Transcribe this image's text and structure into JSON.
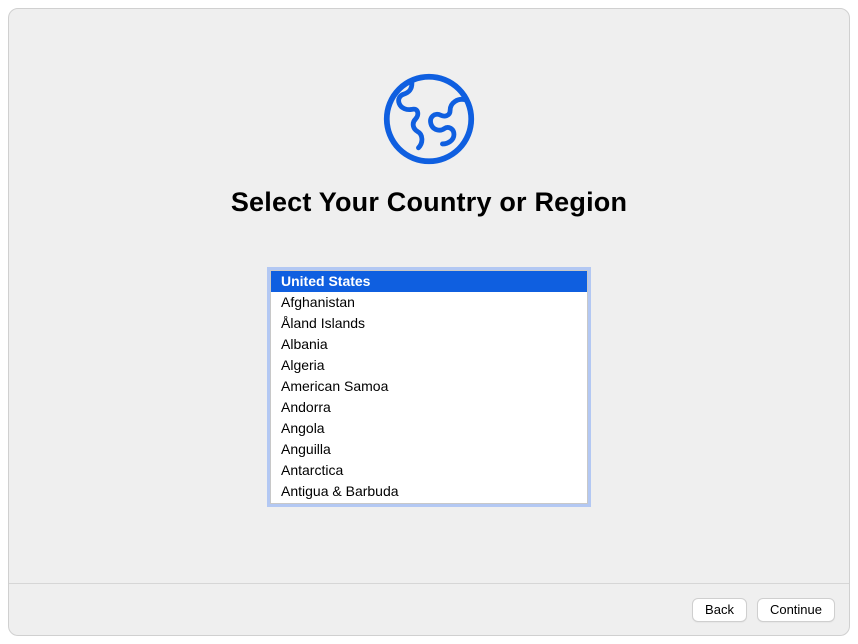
{
  "title": "Select Your Country or Region",
  "icon": "globe-icon",
  "accent_color": "#0f5fe0",
  "countries": {
    "selected_index": 0,
    "items": [
      "United States",
      "Afghanistan",
      "Åland Islands",
      "Albania",
      "Algeria",
      "American Samoa",
      "Andorra",
      "Angola",
      "Anguilla",
      "Antarctica",
      "Antigua & Barbuda"
    ]
  },
  "buttons": {
    "back": "Back",
    "continue": "Continue"
  }
}
